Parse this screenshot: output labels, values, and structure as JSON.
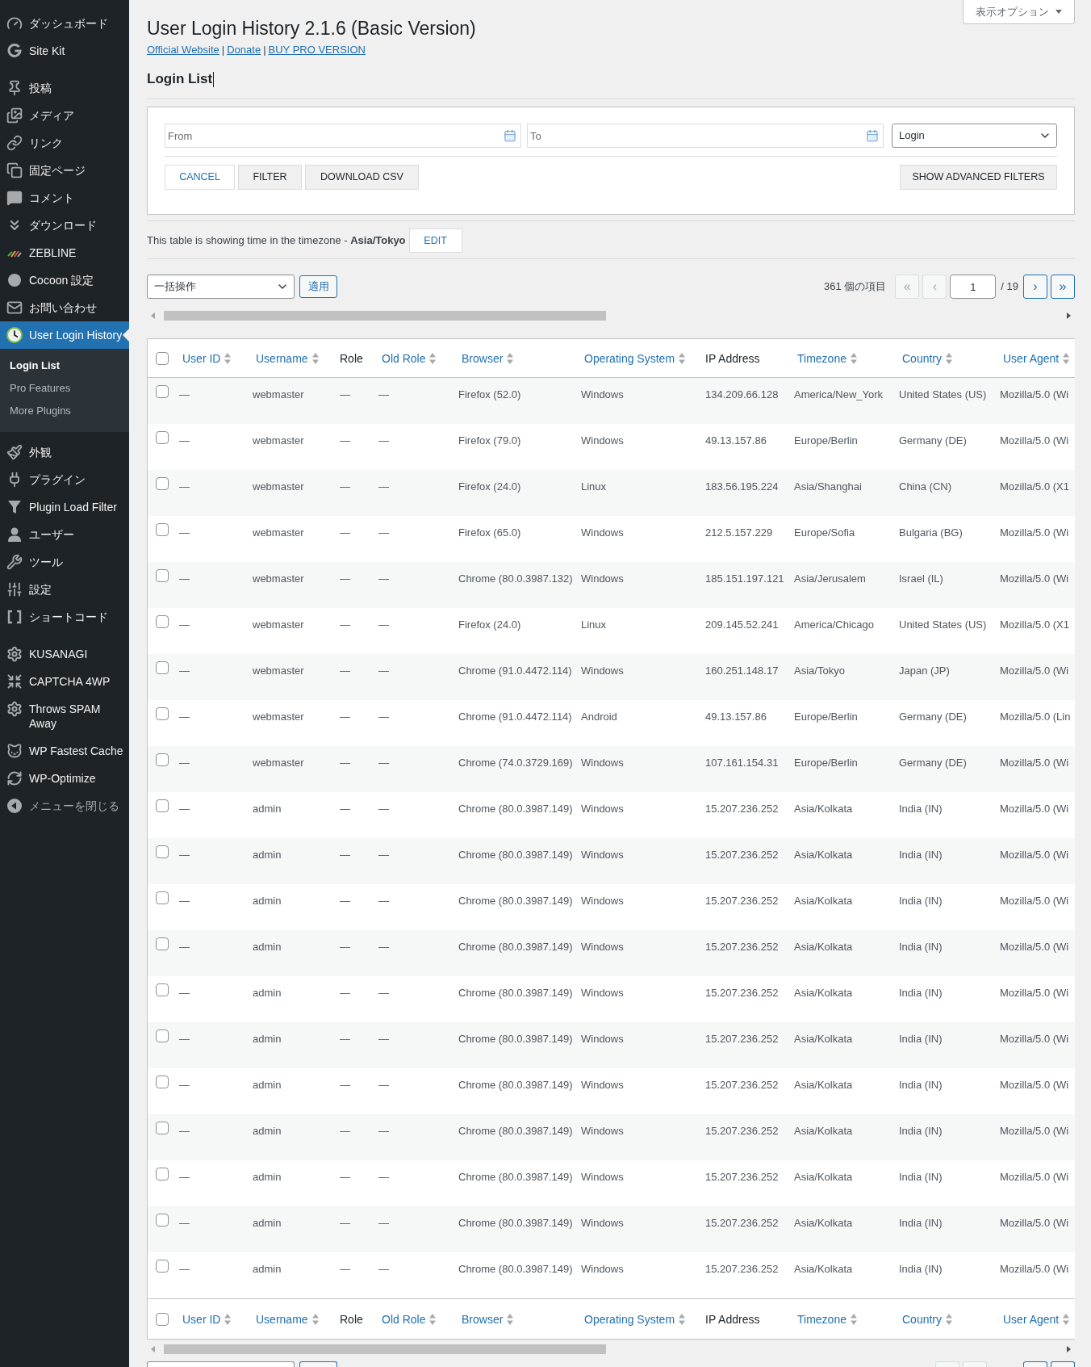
{
  "sidebar": {
    "groups": [
      {
        "items": [
          {
            "label": "ダッシュボード",
            "selected": false
          },
          {
            "label": "Site Kit",
            "selected": false
          }
        ]
      },
      {
        "items": [
          {
            "label": "投稿",
            "selected": false
          },
          {
            "label": "メディア",
            "selected": false
          },
          {
            "label": "リンク",
            "selected": false
          },
          {
            "label": "固定ページ",
            "selected": false
          },
          {
            "label": "コメント",
            "selected": false
          },
          {
            "label": "ダウンロード",
            "selected": false
          },
          {
            "label": "ZEBLINE",
            "selected": false
          },
          {
            "label": "Cocoon 設定",
            "selected": false
          },
          {
            "label": "お問い合わせ",
            "selected": false
          },
          {
            "label": "User Login History",
            "selected": true,
            "children": [
              {
                "label": "Login List",
                "selected": true
              },
              {
                "label": "Pro Features",
                "selected": false
              },
              {
                "label": "More Plugins",
                "selected": false
              }
            ]
          },
          {
            "label": "外観",
            "selected": false
          },
          {
            "label": "プラグイン",
            "selected": false
          },
          {
            "label": "Plugin Load Filter",
            "selected": false
          },
          {
            "label": "ユーザー",
            "selected": false
          },
          {
            "label": "ツール",
            "selected": false
          },
          {
            "label": "設定",
            "selected": false
          },
          {
            "label": "ショートコード",
            "selected": false
          }
        ]
      },
      {
        "items": [
          {
            "label": "KUSANAGI",
            "selected": false
          },
          {
            "label": "CAPTCHA 4WP",
            "selected": false
          },
          {
            "label": "Throws SPAM\nAway",
            "selected": false
          },
          {
            "label": "WP Fastest Cache",
            "selected": false
          },
          {
            "label": "WP-Optimize",
            "selected": false
          }
        ]
      }
    ],
    "collapse_button": {
      "label": "メニューを閉じる"
    }
  },
  "screen_options": {
    "label": "表示オプション",
    "expanded": false
  },
  "header": {
    "title": "User Login History 2.1.6 (Basic Version)",
    "links": [
      {
        "label": "Official Website",
        "separator": "|"
      },
      {
        "label": "Donate",
        "separator": "|"
      },
      {
        "label": "BUY PRO VERSION"
      }
    ],
    "subtitle": "Login List"
  },
  "filters": {
    "from": {
      "placeholder": "From"
    },
    "to": {
      "placeholder": "To"
    },
    "type_select": {
      "value": "Login"
    },
    "buttons": [
      {
        "label": "CANCEL",
        "kind": "outline"
      },
      {
        "label": "FILTER",
        "kind": "secondary"
      },
      {
        "label": "DOWNLOAD CSV",
        "kind": "secondary"
      }
    ],
    "advanced_button": {
      "label": "SHOW ADVANCED FILTERS"
    }
  },
  "timezone": {
    "text": "This table is showing time in the timezone - **Asia/Tokyo**",
    "edit_button": "EDIT"
  },
  "bulk_actions": {
    "select": {
      "value": "一括操作"
    },
    "apply_button": "適用"
  },
  "pagination": {
    "count": "361 個の項目",
    "first": {
      "label": "«",
      "disabled": true
    },
    "prev": {
      "label": "‹",
      "disabled": true
    },
    "page_input": {
      "value": "1"
    },
    "total": "/ 19",
    "next": {
      "label": "›",
      "disabled": false
    },
    "last": {
      "label": "»",
      "disabled": false
    }
  },
  "table": {
    "header_checkbox": {
      "checked": false
    },
    "columns": [
      {
        "label": "User ID",
        "sortable": true
      },
      {
        "label": "Username",
        "sortable": true
      },
      {
        "label": "Role",
        "sortable": false
      },
      {
        "label": "Old Role",
        "sortable": true
      },
      {
        "label": "Browser",
        "sortable": true
      },
      {
        "label": "Operating System",
        "sortable": true
      },
      {
        "label": "IP Address",
        "sortable": false
      },
      {
        "label": "Timezone",
        "sortable": true
      },
      {
        "label": "Country",
        "sortable": true
      },
      {
        "label": "User Agent",
        "sortable": true
      }
    ],
    "rows": [
      {
        "checked": false,
        "cells": [
          "—",
          "webmaster",
          "—",
          "—",
          "Firefox (52.0)",
          "Windows",
          "134.209.66.128",
          "America/New_York",
          "United States (US)",
          "Mozilla/5.0 (Wi"
        ]
      },
      {
        "checked": false,
        "cells": [
          "—",
          "webmaster",
          "—",
          "—",
          "Firefox (79.0)",
          "Windows",
          "49.13.157.86",
          "Europe/Berlin",
          "Germany (DE)",
          "Mozilla/5.0 (Wi"
        ]
      },
      {
        "checked": false,
        "cells": [
          "—",
          "webmaster",
          "—",
          "—",
          "Firefox (24.0)",
          "Linux",
          "183.56.195.224",
          "Asia/Shanghai",
          "China (CN)",
          "Mozilla/5.0 (X1"
        ]
      },
      {
        "checked": false,
        "cells": [
          "—",
          "webmaster",
          "—",
          "—",
          "Firefox (65.0)",
          "Windows",
          "212.5.157.229",
          "Europe/Sofia",
          "Bulgaria (BG)",
          "Mozilla/5.0 (Wi"
        ]
      },
      {
        "checked": false,
        "cells": [
          "—",
          "webmaster",
          "—",
          "—",
          "Chrome (80.0.3987.132)",
          "Windows",
          "185.151.197.121",
          "Asia/Jerusalem",
          "Israel (IL)",
          "Mozilla/5.0 (Wi"
        ]
      },
      {
        "checked": false,
        "cells": [
          "—",
          "webmaster",
          "—",
          "—",
          "Firefox (24.0)",
          "Linux",
          "209.145.52.241",
          "America/Chicago",
          "United States (US)",
          "Mozilla/5.0 (X1"
        ]
      },
      {
        "checked": false,
        "cells": [
          "—",
          "webmaster",
          "—",
          "—",
          "Chrome (91.0.4472.114)",
          "Windows",
          "160.251.148.17",
          "Asia/Tokyo",
          "Japan (JP)",
          "Mozilla/5.0 (Wi"
        ]
      },
      {
        "checked": false,
        "cells": [
          "—",
          "webmaster",
          "—",
          "—",
          "Chrome (91.0.4472.114)",
          "Android",
          "49.13.157.86",
          "Europe/Berlin",
          "Germany (DE)",
          "Mozilla/5.0 (Lin"
        ]
      },
      {
        "checked": false,
        "cells": [
          "—",
          "webmaster",
          "—",
          "—",
          "Chrome (74.0.3729.169)",
          "Windows",
          "107.161.154.31",
          "Europe/Berlin",
          "Germany (DE)",
          "Mozilla/5.0 (Wi"
        ]
      },
      {
        "checked": false,
        "cells": [
          "—",
          "admin",
          "—",
          "—",
          "Chrome (80.0.3987.149)",
          "Windows",
          "15.207.236.252",
          "Asia/Kolkata",
          "India (IN)",
          "Mozilla/5.0 (Wi"
        ]
      },
      {
        "checked": false,
        "cells": [
          "—",
          "admin",
          "—",
          "—",
          "Chrome (80.0.3987.149)",
          "Windows",
          "15.207.236.252",
          "Asia/Kolkata",
          "India (IN)",
          "Mozilla/5.0 (Wi"
        ]
      },
      {
        "checked": false,
        "cells": [
          "—",
          "admin",
          "—",
          "—",
          "Chrome (80.0.3987.149)",
          "Windows",
          "15.207.236.252",
          "Asia/Kolkata",
          "India (IN)",
          "Mozilla/5.0 (Wi"
        ]
      },
      {
        "checked": false,
        "cells": [
          "—",
          "admin",
          "—",
          "—",
          "Chrome (80.0.3987.149)",
          "Windows",
          "15.207.236.252",
          "Asia/Kolkata",
          "India (IN)",
          "Mozilla/5.0 (Wi"
        ]
      },
      {
        "checked": false,
        "cells": [
          "—",
          "admin",
          "—",
          "—",
          "Chrome (80.0.3987.149)",
          "Windows",
          "15.207.236.252",
          "Asia/Kolkata",
          "India (IN)",
          "Mozilla/5.0 (Wi"
        ]
      },
      {
        "checked": false,
        "cells": [
          "—",
          "admin",
          "—",
          "—",
          "Chrome (80.0.3987.149)",
          "Windows",
          "15.207.236.252",
          "Asia/Kolkata",
          "India (IN)",
          "Mozilla/5.0 (Wi"
        ]
      },
      {
        "checked": false,
        "cells": [
          "—",
          "admin",
          "—",
          "—",
          "Chrome (80.0.3987.149)",
          "Windows",
          "15.207.236.252",
          "Asia/Kolkata",
          "India (IN)",
          "Mozilla/5.0 (Wi"
        ]
      },
      {
        "checked": false,
        "cells": [
          "—",
          "admin",
          "—",
          "—",
          "Chrome (80.0.3987.149)",
          "Windows",
          "15.207.236.252",
          "Asia/Kolkata",
          "India (IN)",
          "Mozilla/5.0 (Wi"
        ]
      },
      {
        "checked": false,
        "cells": [
          "—",
          "admin",
          "—",
          "—",
          "Chrome (80.0.3987.149)",
          "Windows",
          "15.207.236.252",
          "Asia/Kolkata",
          "India (IN)",
          "Mozilla/5.0 (Wi"
        ]
      },
      {
        "checked": false,
        "cells": [
          "—",
          "admin",
          "—",
          "—",
          "Chrome (80.0.3987.149)",
          "Windows",
          "15.207.236.252",
          "Asia/Kolkata",
          "India (IN)",
          "Mozilla/5.0 (Wi"
        ]
      },
      {
        "checked": false,
        "cells": [
          "—",
          "admin",
          "—",
          "—",
          "Chrome (80.0.3987.149)",
          "Windows",
          "15.207.236.252",
          "Asia/Kolkata",
          "India (IN)",
          "Mozilla/5.0 (Wi"
        ]
      }
    ],
    "footer_checkbox": {
      "checked": false
    },
    "footer_columns": [
      {
        "label": "User ID",
        "sortable": true
      },
      {
        "label": "Username",
        "sortable": true
      },
      {
        "label": "Role",
        "sortable": false
      },
      {
        "label": "Old Role",
        "sortable": true
      },
      {
        "label": "Browser",
        "sortable": true
      },
      {
        "label": "Operating System",
        "sortable": true
      },
      {
        "label": "IP Address",
        "sortable": false
      },
      {
        "label": "Timezone",
        "sortable": true
      },
      {
        "label": "Country",
        "sortable": true
      },
      {
        "label": "User Agent",
        "sortable": true
      }
    ]
  },
  "bottom_pagination": {
    "first": {
      "disabled": true
    },
    "prev": {
      "disabled": true
    },
    "next": {
      "disabled": false
    },
    "last": {
      "disabled": false
    }
  }
}
